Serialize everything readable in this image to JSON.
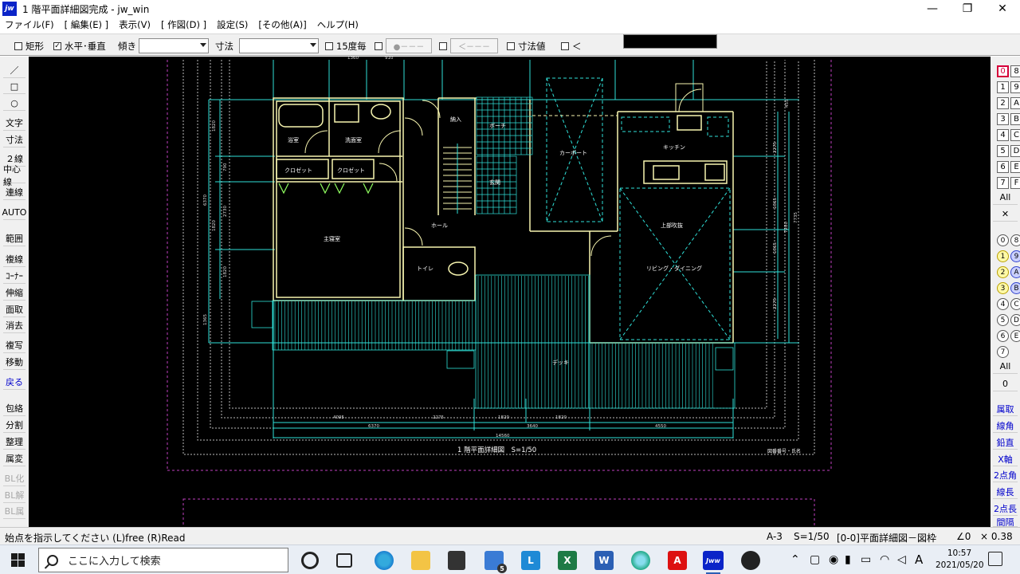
{
  "window": {
    "app_icon_text": "jw",
    "title": "1 階平面詳細図完成 - jw_win",
    "minimize": "—",
    "maximize": "❐",
    "close": "✕"
  },
  "menu": [
    "ファイル(F)",
    "[ 編集(E) ]",
    "表示(V)",
    "[ 作図(D) ]",
    "設定(S)",
    "[その他(A)]",
    "ヘルプ(H)"
  ],
  "options": {
    "rect_label": "矩形",
    "rect_checked": false,
    "hv_label": "水平･垂直",
    "hv_checked": true,
    "tilt_label": "傾き",
    "dim_label": "寸法",
    "deg15_label": "15度毎",
    "btn1_label": "●－－－",
    "btn2_label": "＜－－－",
    "dimval_label": "寸法値",
    "lt_label": "＜"
  },
  "left_tools": [
    {
      "label": "／",
      "dim": false
    },
    {
      "label": "□",
      "dim": false
    },
    {
      "label": "○",
      "dim": false
    },
    {
      "label": "文字",
      "dim": false
    },
    {
      "label": "寸法",
      "dim": false
    },
    {
      "label": "２線",
      "dim": false
    },
    {
      "label": "中心線",
      "dim": false
    },
    {
      "label": "連線",
      "dim": false
    },
    {
      "label": "AUTO",
      "dim": false
    },
    {
      "label": "範囲",
      "dim": false
    },
    {
      "label": "複線",
      "dim": false
    },
    {
      "label": "ｺｰﾅｰ",
      "dim": false
    },
    {
      "label": "伸縮",
      "dim": false
    },
    {
      "label": "面取",
      "dim": false
    },
    {
      "label": "消去",
      "dim": false
    },
    {
      "label": "複写",
      "dim": false
    },
    {
      "label": "移動",
      "dim": false
    },
    {
      "label": "戻る",
      "dim": false
    },
    {
      "label": "包絡",
      "dim": false
    },
    {
      "label": "分割",
      "dim": false
    },
    {
      "label": "整理",
      "dim": false
    },
    {
      "label": "属変",
      "dim": false
    },
    {
      "label": "BL化",
      "dim": true
    },
    {
      "label": "BL解",
      "dim": true
    },
    {
      "label": "BL属",
      "dim": true
    }
  ],
  "layers": [
    "0",
    "8",
    "1",
    "9",
    "2",
    "A",
    "3",
    "B",
    "4",
    "C",
    "5",
    "D",
    "6",
    "E",
    "7",
    "F"
  ],
  "layers_all": "All",
  "layers_x": "✕",
  "groups": [
    "0",
    "8",
    "1",
    "9",
    "2",
    "A",
    "3",
    "B",
    "4",
    "C",
    "5",
    "D",
    "6",
    "E",
    "7"
  ],
  "groups_all": "All",
  "groups_zero": "0",
  "right_tools": [
    "属取",
    "線角",
    "鉛直",
    "X軸",
    "2点角",
    "線長",
    "2点長",
    "間隔"
  ],
  "drawing": {
    "rooms": {
      "bath": "浴室",
      "washroom": "洗面室",
      "storage": "納入",
      "porch": "ポーチ",
      "carport": "カーポート",
      "kitchen": "キッチン",
      "closet1": "クロゼット",
      "closet2": "クロゼット",
      "entrance": "玄関",
      "hall": "ホール",
      "master": "主寝室",
      "void": "上部吹抜",
      "living": "リビング・ダイニング",
      "toilet": "トイレ",
      "deck": "デッキ"
    },
    "dims_top": [
      "1360",
      "910"
    ],
    "dims_left": [
      "1820",
      "790",
      "6370",
      "2730",
      "1820",
      "1820",
      "1365"
    ],
    "dims_right": [
      "455",
      "2275",
      "1365",
      "1365",
      "7280",
      "7735",
      "2275"
    ],
    "dims_bottom_row1": [
      "4095",
      "2275",
      "1820",
      "1820"
    ],
    "dims_bottom_row2": [
      "6370",
      "3640",
      "4550"
    ],
    "dims_bottom_total": "14560",
    "drawing_title": "1 階平面詳細図　S=1/50",
    "drawing_no": "図番番号・氏名"
  },
  "status": {
    "message": "始点を指示してください  (L)free  (R)Read",
    "paper": "A-3",
    "scale": "S=1/50",
    "layer": "[0-0]平面詳細図－図枠",
    "angle": "∠0",
    "zoom": "× 0.38"
  },
  "taskbar": {
    "search_placeholder": "ここに入力して検索",
    "mail_badge": "5",
    "excel": "X",
    "word": "W",
    "line": "L",
    "acrobat": "A",
    "jw": "Jww",
    "ime": "A",
    "time": "10:57",
    "date": "2021/05/20"
  }
}
